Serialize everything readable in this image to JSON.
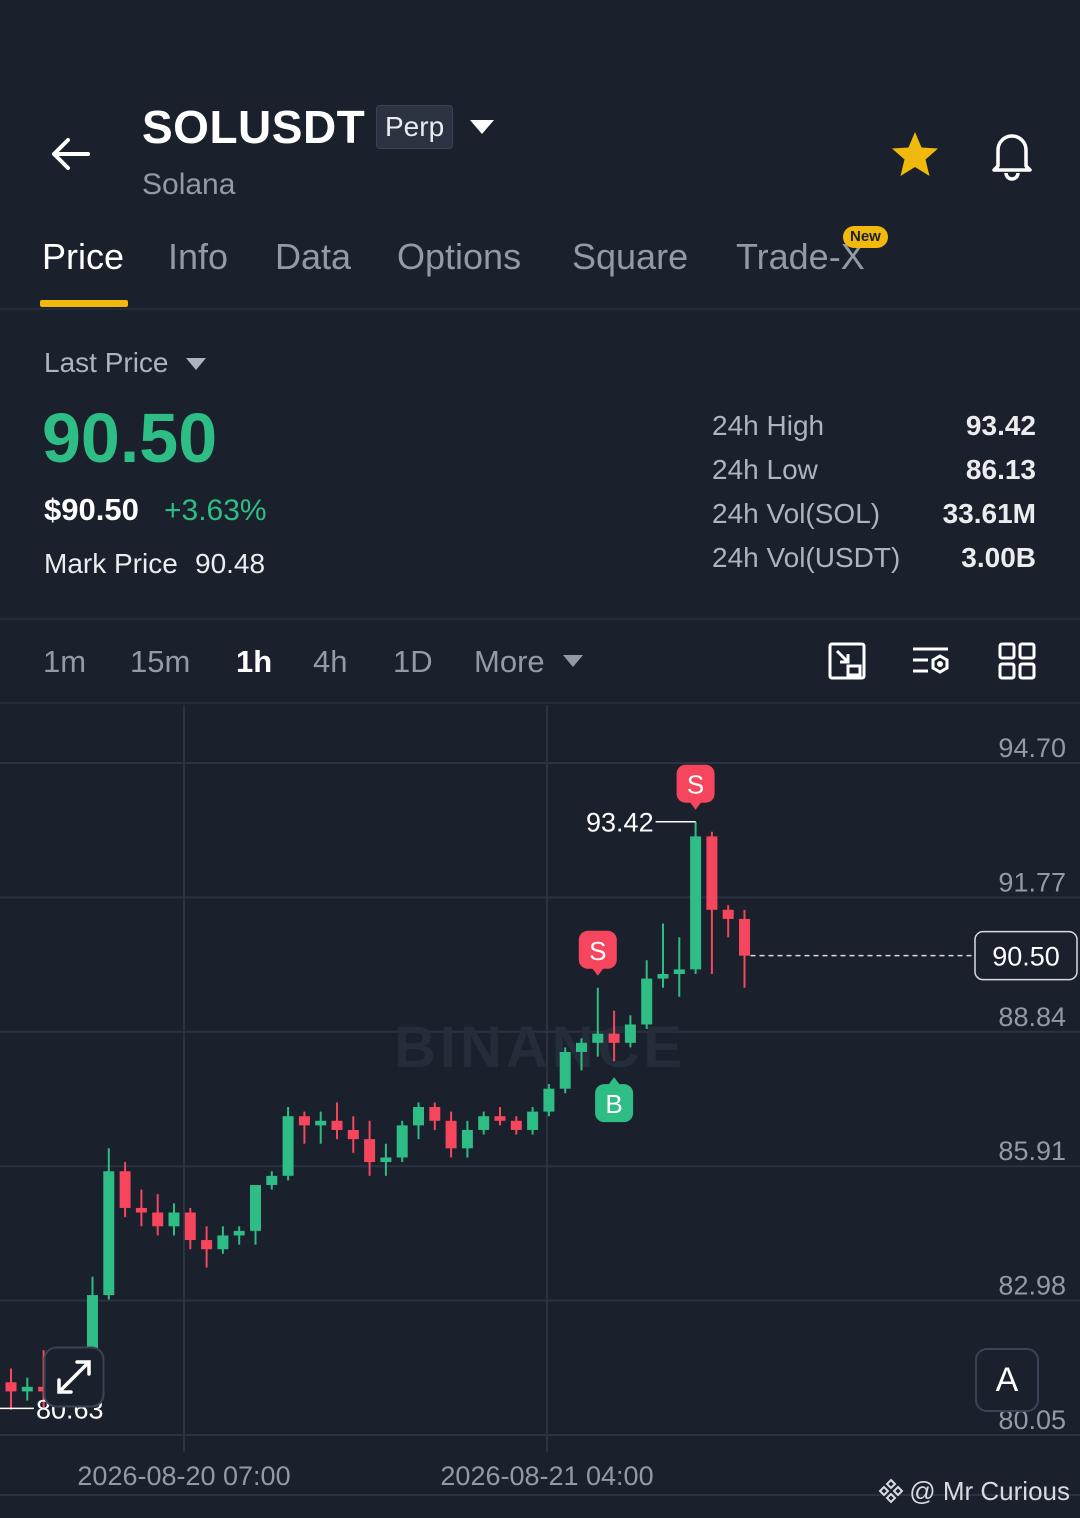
{
  "header": {
    "symbol": "SOLUSDT",
    "contract_type": "Perp",
    "coin_name": "Solana"
  },
  "tabs": [
    {
      "label": "Price",
      "active": true
    },
    {
      "label": "Info"
    },
    {
      "label": "Data"
    },
    {
      "label": "Options"
    },
    {
      "label": "Square"
    },
    {
      "label": "Trade-X",
      "badge": "New"
    }
  ],
  "price_block": {
    "last_price_label": "Last Price",
    "last_price": "90.50",
    "usd_price": "$90.50",
    "change_pct": "+3.63%",
    "mark_price_label": "Mark Price",
    "mark_price": "90.48"
  },
  "stats": [
    {
      "label": "24h High",
      "value": "93.42"
    },
    {
      "label": "24h Low",
      "value": "86.13"
    },
    {
      "label": "24h Vol(SOL)",
      "value": "33.61M"
    },
    {
      "label": "24h Vol(USDT)",
      "value": "3.00B"
    }
  ],
  "intervals": [
    {
      "label": "1m"
    },
    {
      "label": "15m"
    },
    {
      "label": "1h",
      "active": true
    },
    {
      "label": "4h"
    },
    {
      "label": "1D"
    },
    {
      "label": "More"
    }
  ],
  "colors": {
    "up": "#2ebd85",
    "down": "#f6465d",
    "accent": "#f0b90b",
    "background": "#1a202c",
    "grid": "#2b3240"
  },
  "chart_data": {
    "type": "candlestick",
    "watermark": "BINANCE",
    "y_ticks": [
      94.7,
      91.77,
      88.84,
      85.91,
      82.98,
      80.05
    ],
    "ylim": [
      80.05,
      94.7
    ],
    "x_tick_labels": [
      "2026-08-20 07:00",
      "2026-08-21 04:00"
    ],
    "current_price_label": "90.50",
    "high_marker_label": "93.42",
    "low_marker_label": "80.63",
    "candles": [
      {
        "o": 81.2,
        "h": 81.5,
        "l": 80.6,
        "c": 81.0
      },
      {
        "o": 81.0,
        "h": 81.3,
        "l": 80.8,
        "c": 81.1
      },
      {
        "o": 81.1,
        "h": 81.9,
        "l": 80.6,
        "c": 81.0
      },
      {
        "o": 81.0,
        "h": 81.6,
        "l": 80.9,
        "c": 81.6
      },
      {
        "o": 81.6,
        "h": 81.9,
        "l": 81.4,
        "c": 81.7
      },
      {
        "o": 81.7,
        "h": 83.5,
        "l": 81.6,
        "c": 83.1
      },
      {
        "o": 83.1,
        "h": 86.3,
        "l": 83.0,
        "c": 85.8
      },
      {
        "o": 85.8,
        "h": 86.0,
        "l": 84.8,
        "c": 85.0
      },
      {
        "o": 85.0,
        "h": 85.4,
        "l": 84.6,
        "c": 84.9
      },
      {
        "o": 84.9,
        "h": 85.3,
        "l": 84.4,
        "c": 84.6
      },
      {
        "o": 84.6,
        "h": 85.1,
        "l": 84.4,
        "c": 84.9
      },
      {
        "o": 84.9,
        "h": 85.0,
        "l": 84.1,
        "c": 84.3
      },
      {
        "o": 84.3,
        "h": 84.6,
        "l": 83.7,
        "c": 84.1
      },
      {
        "o": 84.1,
        "h": 84.6,
        "l": 84.0,
        "c": 84.4
      },
      {
        "o": 84.4,
        "h": 84.6,
        "l": 84.2,
        "c": 84.5
      },
      {
        "o": 84.5,
        "h": 85.5,
        "l": 84.2,
        "c": 85.5
      },
      {
        "o": 85.5,
        "h": 85.8,
        "l": 85.4,
        "c": 85.7
      },
      {
        "o": 85.7,
        "h": 87.2,
        "l": 85.6,
        "c": 87.0
      },
      {
        "o": 87.0,
        "h": 87.1,
        "l": 86.4,
        "c": 86.8
      },
      {
        "o": 86.8,
        "h": 87.1,
        "l": 86.4,
        "c": 86.9
      },
      {
        "o": 86.9,
        "h": 87.3,
        "l": 86.5,
        "c": 86.7
      },
      {
        "o": 86.7,
        "h": 87.0,
        "l": 86.2,
        "c": 86.5
      },
      {
        "o": 86.5,
        "h": 86.9,
        "l": 85.7,
        "c": 86.0
      },
      {
        "o": 86.0,
        "h": 86.4,
        "l": 85.7,
        "c": 86.1
      },
      {
        "o": 86.1,
        "h": 86.9,
        "l": 86.0,
        "c": 86.8
      },
      {
        "o": 86.8,
        "h": 87.3,
        "l": 86.5,
        "c": 87.2
      },
      {
        "o": 87.2,
        "h": 87.3,
        "l": 86.7,
        "c": 86.9
      },
      {
        "o": 86.9,
        "h": 87.1,
        "l": 86.1,
        "c": 86.3
      },
      {
        "o": 86.3,
        "h": 86.9,
        "l": 86.1,
        "c": 86.7
      },
      {
        "o": 86.7,
        "h": 87.1,
        "l": 86.6,
        "c": 87.0
      },
      {
        "o": 87.0,
        "h": 87.2,
        "l": 86.8,
        "c": 86.9
      },
      {
        "o": 86.9,
        "h": 87.0,
        "l": 86.6,
        "c": 86.7
      },
      {
        "o": 86.7,
        "h": 87.2,
        "l": 86.6,
        "c": 87.1
      },
      {
        "o": 87.1,
        "h": 87.7,
        "l": 87.0,
        "c": 87.6
      },
      {
        "o": 87.6,
        "h": 88.5,
        "l": 87.5,
        "c": 88.4
      },
      {
        "o": 88.4,
        "h": 88.7,
        "l": 88.0,
        "c": 88.6
      },
      {
        "o": 88.6,
        "h": 89.8,
        "l": 88.3,
        "c": 88.8
      },
      {
        "o": 88.8,
        "h": 89.3,
        "l": 88.2,
        "c": 88.6
      },
      {
        "o": 88.6,
        "h": 89.2,
        "l": 88.5,
        "c": 89.0
      },
      {
        "o": 89.0,
        "h": 90.4,
        "l": 88.9,
        "c": 90.0
      },
      {
        "o": 90.0,
        "h": 91.2,
        "l": 89.8,
        "c": 90.1
      },
      {
        "o": 90.1,
        "h": 90.9,
        "l": 89.6,
        "c": 90.2
      },
      {
        "o": 90.2,
        "h": 93.42,
        "l": 90.1,
        "c": 93.1
      },
      {
        "o": 93.1,
        "h": 93.2,
        "l": 90.1,
        "c": 91.5
      },
      {
        "o": 91.5,
        "h": 91.6,
        "l": 90.9,
        "c": 91.3
      },
      {
        "o": 91.3,
        "h": 91.5,
        "l": 89.8,
        "c": 90.5
      }
    ],
    "trade_markers": [
      {
        "label": "S",
        "candle": 36,
        "side": "sell"
      },
      {
        "label": "B",
        "candle": 37,
        "side": "buy"
      },
      {
        "label": "S",
        "candle": 42,
        "side": "sell"
      }
    ]
  },
  "chart_controls": {
    "expand_icon": "expand-icon",
    "auto_button": "A"
  },
  "footer": {
    "credit": "@ Mr Curious"
  }
}
